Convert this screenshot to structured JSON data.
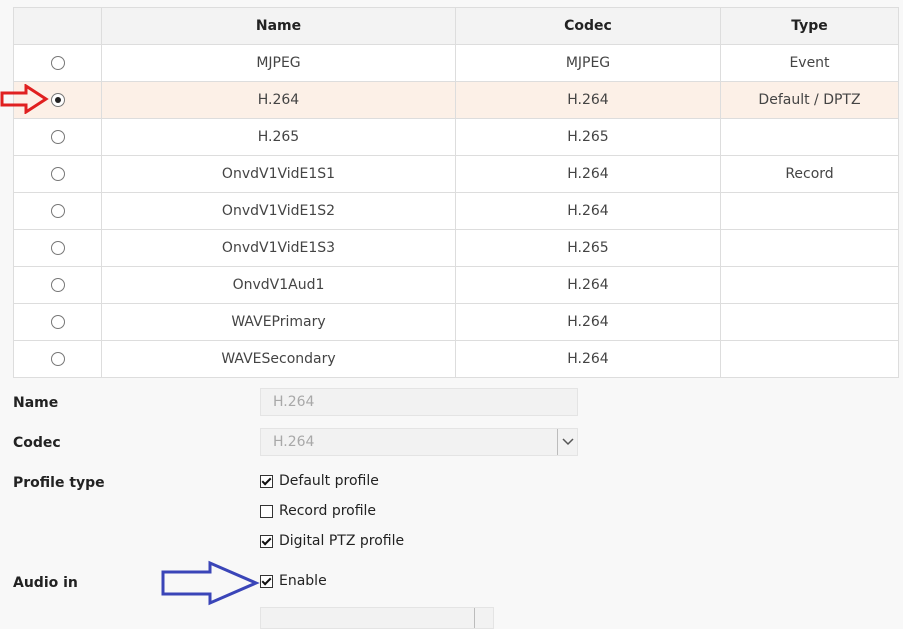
{
  "table": {
    "headers": [
      "",
      "Name",
      "Codec",
      "Type"
    ],
    "rows": [
      {
        "name": "MJPEG",
        "codec": "MJPEG",
        "type": "Event",
        "selected": false
      },
      {
        "name": "H.264",
        "codec": "H.264",
        "type": "Default / DPTZ",
        "selected": true
      },
      {
        "name": "H.265",
        "codec": "H.265",
        "type": "",
        "selected": false
      },
      {
        "name": "OnvdV1VidE1S1",
        "codec": "H.264",
        "type": "Record",
        "selected": false
      },
      {
        "name": "OnvdV1VidE1S2",
        "codec": "H.264",
        "type": "",
        "selected": false
      },
      {
        "name": "OnvdV1VidE1S3",
        "codec": "H.265",
        "type": "",
        "selected": false
      },
      {
        "name": "OnvdV1Aud1",
        "codec": "H.264",
        "type": "",
        "selected": false
      },
      {
        "name": "WAVEPrimary",
        "codec": "H.264",
        "type": "",
        "selected": false
      },
      {
        "name": "WAVESecondary",
        "codec": "H.264",
        "type": "",
        "selected": false
      }
    ]
  },
  "form": {
    "name_label": "Name",
    "name_value": "H.264",
    "codec_label": "Codec",
    "codec_value": "H.264",
    "profile_type_label": "Profile type",
    "profiles": [
      {
        "label": "Default profile",
        "checked": true
      },
      {
        "label": "Record profile",
        "checked": false
      },
      {
        "label": "Digital PTZ profile",
        "checked": true
      }
    ],
    "audio_in_label": "Audio in",
    "audio_enable_label": "Enable",
    "audio_enable_checked": true
  },
  "annotations": {
    "red_arrow_color": "#e02020",
    "blue_arrow_color": "#3a45b8",
    "icons": [
      "right-arrow-icon",
      "chevron-down-icon"
    ]
  }
}
